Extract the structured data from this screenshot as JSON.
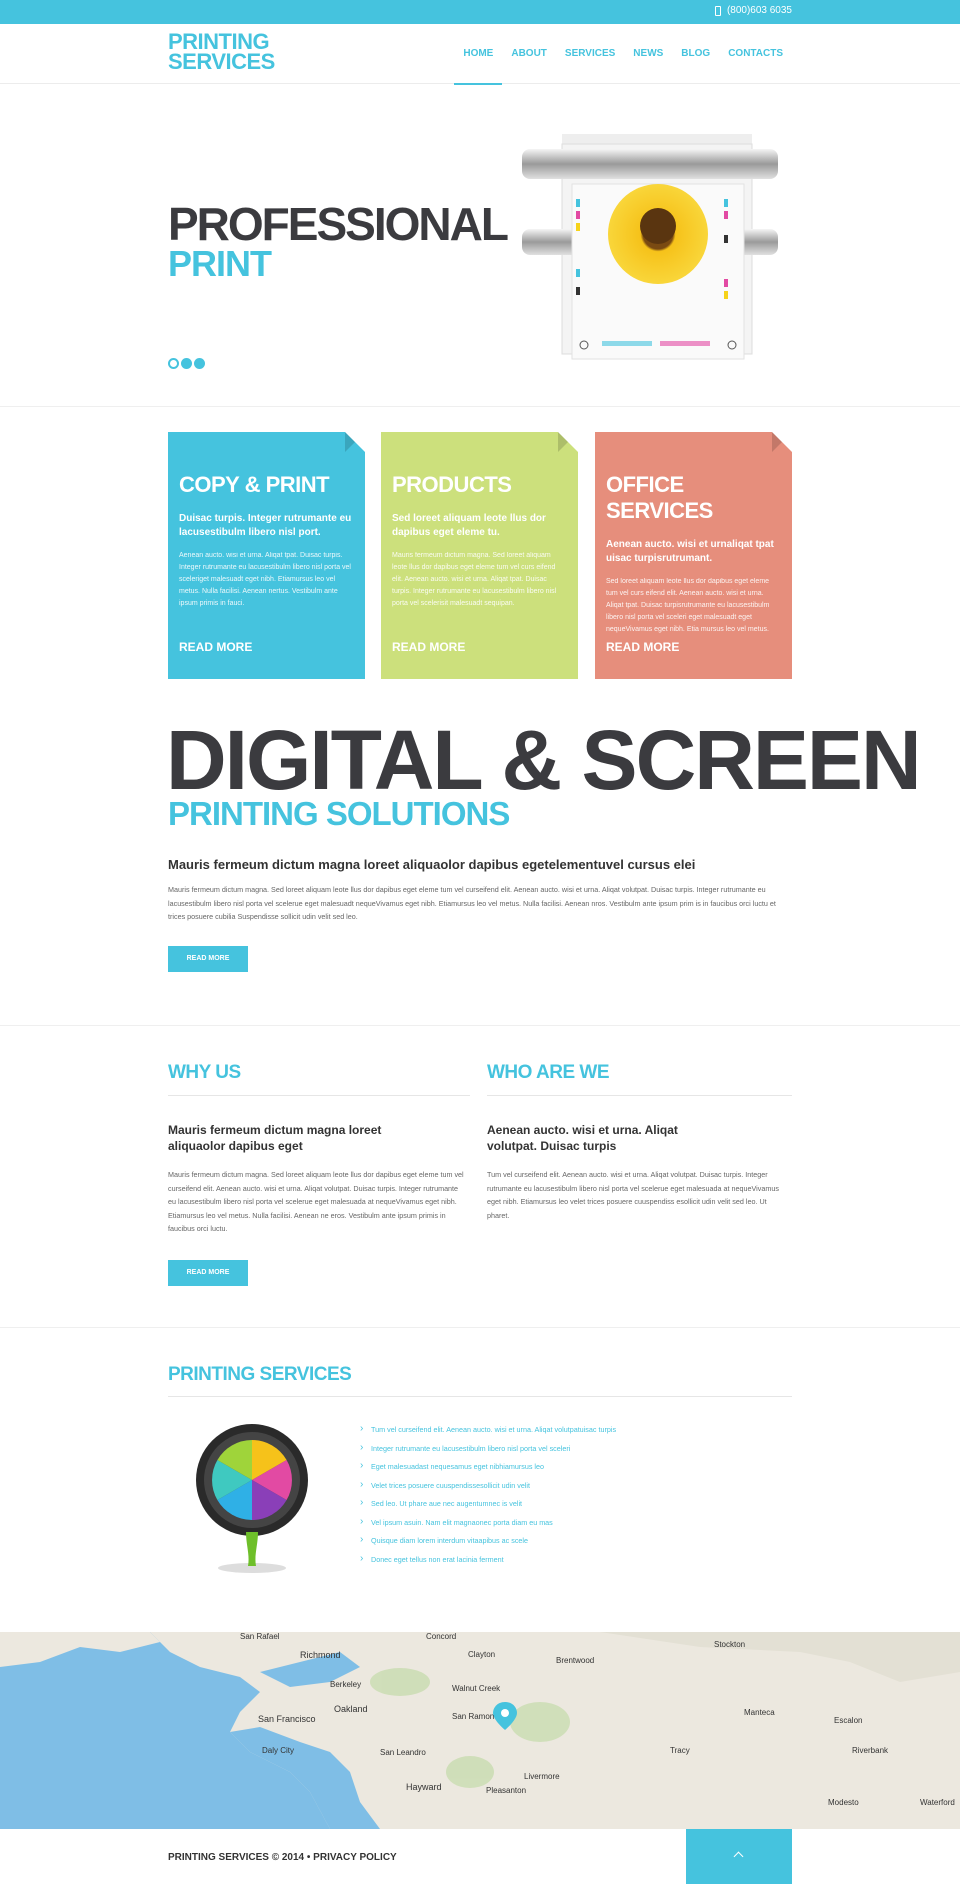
{
  "topbar": {
    "phone": "(800)603 6035",
    "phone_icon": "mobile-phone-icon"
  },
  "header": {
    "logo_line1": "PRINTING",
    "logo_line2": "SERVICES",
    "nav": [
      "HOME",
      "ABOUT",
      "SERVICES",
      "NEWS",
      "BLOG",
      "CONTACTS"
    ],
    "active": "HOME"
  },
  "hero": {
    "title_line1": "PROFESSIONAL",
    "title_line2": "PRINT",
    "slides": 3,
    "active_slide": 1
  },
  "boxes": [
    {
      "title": "COPY & PRINT",
      "lead": "Duisac turpis. Integer rutrumante eu lacusestibulm libero nisl port.",
      "body": "Aenean aucto. wisi et urna. Aliqat tpat. Duisac turpis. Integer rutrumante eu lacusestibulm libero nisl porta vel sceleriget malesuadt eget nibh. Etiamursus leo vel metus. Nulla facilisi. Aenean nertus. Vestibulm ante ipsum primis in fauci.",
      "more": "READ MORE",
      "color": "#45c3de"
    },
    {
      "title": "PRODUCTS",
      "lead": "Sed loreet aliquam leote llus dor dapibus eget eleme tu.",
      "body": "Mauris fermeum dictum magna. Sed loreet aliquam leote llus dor dapibus eget eleme tum vel curs eifend elit. Aenean aucto. wisi et urna. Aliqat tpat. Duisac turpis. Integer rutrumante eu lacusestibulm libero nisl porta vel scelerisit malesuadt sequipan.",
      "more": "READ MORE",
      "color": "#cce07c"
    },
    {
      "title": "OFFICE SERVICES",
      "lead": "Aenean aucto. wisi et urnaliqat tpat uisac turpisrutrumant.",
      "body": "Sed loreet aliquam leote llus dor dapibus eget eleme tum vel curs eifend elit. Aenean aucto. wisi et urna. Aliqat tpat. Duisac turpisrutrumante eu lacusestibulm libero nisl porta vel sceleri eget malesuadt eget nequeVivamus eget nibh. Etia mursus leo vel metus.",
      "more": "READ MORE",
      "color": "#e68e7c"
    }
  ],
  "digital": {
    "title_line1": "DIGITAL & SCREEN",
    "title_line2": "PRINTING SOLUTIONS",
    "lead": "Mauris fermeum dictum magna loreet aliquaolor dapibus egetelementuvel cursus elei",
    "body": "Mauris fermeum dictum magna. Sed loreet aliquam leote llus dor dapibus eget eleme tum vel curseifend elit. Aenean aucto. wisi et urna. Aliqat volutpat. Duisac turpis. Integer rutrumante eu lacusestibulm libero nisl porta vel scelerue eget malesuadt nequeVivamus eget nibh. Etiamursus leo vel metus. Nulla facilisi. Aenean nros. Vestibulm ante ipsum prim is in faucibus orci luctu et trices posuere cubilia Suspendisse sollicit udin velit sed leo.",
    "button": "READ MORE"
  },
  "why_us": {
    "title": "WHY US",
    "lead": "Mauris fermeum dictum magna loreet aliquaolor dapibus eget",
    "body": "Mauris fermeum dictum magna. Sed loreet aliquam leote llus dor dapibus eget eleme tum vel curseifend elit. Aenean aucto. wisi et urna. Aliqat volutpat. Duisac turpis. Integer rutrumante eu lacusestibulm libero nisl porta vel scelerue eget malesuada at nequeVivamus eget nibh. Etiamursus leo vel metus. Nulla facilisi. Aenean ne eros. Vestibulm ante ipsum primis in faucibus orci luctu.",
    "button": "READ MORE"
  },
  "who_are_we": {
    "title": "WHO ARE WE",
    "lead": "Aenean aucto. wisi et urna. Aliqat volutpat. Duisac turpis",
    "body": "Tum vel curseifend elit. Aenean aucto. wisi et urna. Aliqat volutpat. Duisac turpis. Integer rutrumante eu lacusestibulm libero nisl porta vel scelerue eget malesuada at nequeVivamus eget nibh. Etiamursus leo velet trices posuere cuuspendiss esollicit udin velit sed leo. Ut pharet."
  },
  "printing_services": {
    "title": "PRINTING SERVICES",
    "items": [
      "Tum vel curseifend elit. Aenean aucto. wisi et urna. Aliqat volutpatuisac turpis",
      "Integer rutrumante eu lacusestibulm libero nisl porta vel sceleri",
      "Eget malesuadast nequesamus eget nibhiamursus leo",
      "Velet trices posuere cuuspendissesollicit udin velit",
      "Sed leo. Ut phare aue nec augentumnec is velit",
      "Vel ipsum asuin. Nam elit magnaonec porta diam eu mas",
      "Quisque diam lorem interdum vitaapibus ac scele",
      "Donec eget tellus non erat lacinia ferment"
    ]
  },
  "map": {
    "labels": [
      "San Rafael",
      "Concord",
      "Stockton",
      "Richmond",
      "Clayton",
      "Brentwood",
      "Berkeley",
      "Walnut Creek",
      "Oakland",
      "Manteca",
      "San Francisco",
      "San Ramon",
      "Escalon",
      "Daly City",
      "Tracy",
      "Riverbank",
      "San Leandro",
      "Livermore",
      "Hayward",
      "Pleasanton",
      "Modesto",
      "Waterford"
    ],
    "water_color": "#7fbee6",
    "land_color": "#ece8df"
  },
  "footer": {
    "copyright": "PRINTING SERVICES © 2014 • PRIVACY POLICY",
    "top_icon": "arrow-up-icon"
  }
}
